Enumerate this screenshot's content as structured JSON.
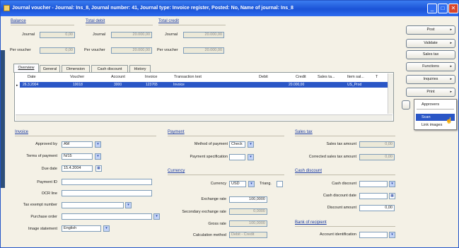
{
  "window": {
    "title": "Journal voucher - Journal: Ins_8, Journal number: 41, Journal type: Invoice register, Posted: No, Name of journal: Ins_8"
  },
  "top": {
    "balance": {
      "heading": "Balance",
      "journal_label": "Journal",
      "journal_value": "0,00",
      "per_voucher_label": "Per voucher",
      "per_voucher_value": "0,00"
    },
    "total_debit": {
      "heading": "Total debit",
      "journal_label": "Journal",
      "journal_value": "20.000,00",
      "per_voucher_label": "Per voucher",
      "per_voucher_value": "20.000,00"
    },
    "total_credit": {
      "heading": "Total credit",
      "journal_label": "Journal",
      "journal_value": "20.000,00",
      "per_voucher_label": "Per voucher",
      "per_voucher_value": "20.000,00"
    }
  },
  "tabs": [
    "Overview",
    "General",
    "Dimension",
    "Cash discount",
    "History"
  ],
  "grid": {
    "columns": [
      "Date",
      "Voucher",
      "Account",
      "Invoice",
      "Transaction text",
      "Debit",
      "Credit",
      "Sales ta...",
      "Item sal...",
      "T"
    ],
    "rows": [
      [
        "26.3.2004",
        "10018",
        "3000",
        "123765",
        "Invoice",
        "",
        "20.000,00",
        "",
        "US_Prod",
        ""
      ]
    ]
  },
  "sections": {
    "invoice": {
      "heading": "Invoice",
      "approved_by_label": "Approved by",
      "approved_by": "AM",
      "terms_label": "Terms of payment",
      "terms": "N/15",
      "due_date_label": "Due date",
      "due_date": "15.4.2004",
      "payment_id_label": "Payment ID",
      "payment_id": "",
      "ocr_label": "OCR line",
      "ocr": "",
      "tax_exempt_label": "Tax exempt number",
      "tax_exempt": "",
      "purchase_order_label": "Purchase order",
      "purchase_order": "",
      "image_statement_label": "Image statement",
      "image_statement": "English"
    },
    "payment": {
      "heading": "Payment",
      "method_label": "Method of payment",
      "method": "Check",
      "spec_label": "Payment specification",
      "spec": ""
    },
    "currency": {
      "heading": "Currency",
      "currency_label": "Currency",
      "currency": "USD",
      "triang_label": "Triang.",
      "exchange_label": "Exchange rate",
      "exchange": "100,0000",
      "secondary_label": "Secondary exchange rate",
      "secondary": "0,0000",
      "gross_label": "Gross rate",
      "gross": "100,0000",
      "calc_label": "Calculation method",
      "calc": "Debit - Credit"
    },
    "sales_tax": {
      "heading": "Sales tax",
      "amount_label": "Sales tax amount",
      "amount": "0,00",
      "corrected_label": "Corrected sales tax amount",
      "corrected": "0,00"
    },
    "cash_discount": {
      "heading": "Cash discount",
      "discount_label": "Cash discount",
      "discount": "",
      "date_label": "Cash discount date",
      "date": "",
      "amount_label": "Discount amount",
      "amount": "0,00"
    },
    "bank": {
      "heading": "Bank of recipient",
      "account_label": "Account identification",
      "account": ""
    }
  },
  "buttons": {
    "post": "Post",
    "validate": "Validate",
    "sales_tax": "Sales tax",
    "functions": "Functions",
    "inquiries": "Inquiries",
    "print": "Print",
    "approvers": "Approvers"
  },
  "context_menu": {
    "items": [
      "Scan",
      "Link images"
    ]
  }
}
